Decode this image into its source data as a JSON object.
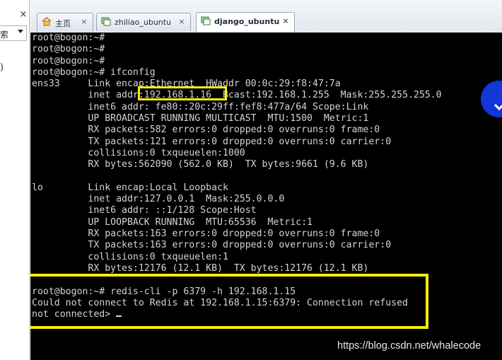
{
  "tabs": [
    {
      "label": "主页",
      "icon": "home-icon",
      "close": "×"
    },
    {
      "label": "zhiliao_ubuntu",
      "icon": "vm-icon",
      "close": "×"
    },
    {
      "label": "django_ubuntu",
      "icon": "vm-icon",
      "close": "×",
      "active": true
    }
  ],
  "sidebar": {
    "close": "×",
    "field_fragment": "索",
    "fragment2": ")"
  },
  "terminal": {
    "lines": [
      "root@bogon:~#",
      "root@bogon:~#",
      "root@bogon:~#",
      "root@bogon:~# ifconfig",
      "ens33     Link encap:Ethernet  HWaddr 00:0c:29:f8:47:7a",
      "          inet addr:192.168.1.16  Bcast:192.168.1.255  Mask:255.255.255.0",
      "          inet6 addr: fe80::20c:29ff:fef8:477a/64 Scope:Link",
      "          UP BROADCAST RUNNING MULTICAST  MTU:1500  Metric:1",
      "          RX packets:582 errors:0 dropped:0 overruns:0 frame:0",
      "          TX packets:121 errors:0 dropped:0 overruns:0 carrier:0",
      "          collisions:0 txqueuelen:1000",
      "          RX bytes:562090 (562.0 KB)  TX bytes:9661 (9.6 KB)",
      "",
      "lo        Link encap:Local Loopback",
      "          inet addr:127.0.0.1  Mask:255.0.0.0",
      "          inet6 addr: ::1/128 Scope:Host",
      "          UP LOOPBACK RUNNING  MTU:65536  Metric:1",
      "          RX packets:163 errors:0 dropped:0 overruns:0 frame:0",
      "          TX packets:163 errors:0 dropped:0 overruns:0 carrier:0",
      "          collisions:0 txqueuelen:1",
      "          RX bytes:12176 (12.1 KB)  TX bytes:12176 (12.1 KB)",
      "",
      "root@bogon:~# redis-cli -p 6379 -h 192.168.1.15",
      "Could not connect to Redis at 192.168.1.15:6379: Connection refused",
      "not connected> "
    ]
  },
  "watermark": "https://blog.csdn.net/whalecode",
  "colors": {
    "highlight": "#f2ee0a",
    "terminal_bg": "#000000",
    "terminal_fg": "#d4d4d4",
    "overlay_button": "#1336d8"
  }
}
